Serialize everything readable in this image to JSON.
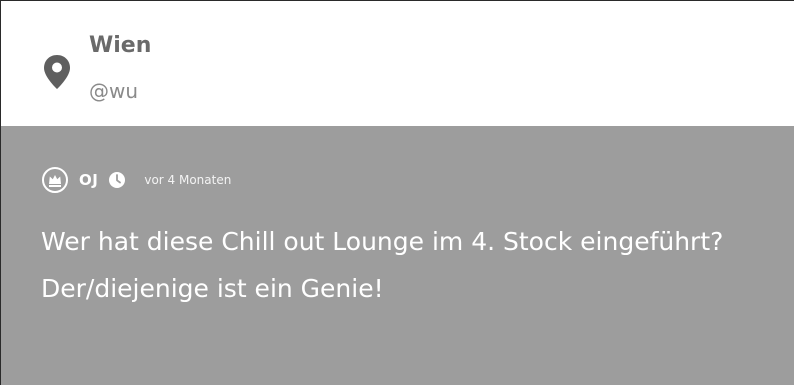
{
  "location": {
    "title": "Wien",
    "handle": "@wu",
    "icon": "map-pin-icon"
  },
  "post": {
    "author": "OJ",
    "author_icon": "crown-badge-icon",
    "time_icon": "clock-icon",
    "timestamp": "vor 4 Monaten",
    "text": "Wer hat diese Chill out Lounge im 4. Stock eingeführt? Der/diejenige ist ein Genie!"
  },
  "colors": {
    "header_bg": "#ffffff",
    "post_bg": "#9d9d9d",
    "text_gray": "#6a6a6a",
    "text_white": "#ffffff"
  }
}
